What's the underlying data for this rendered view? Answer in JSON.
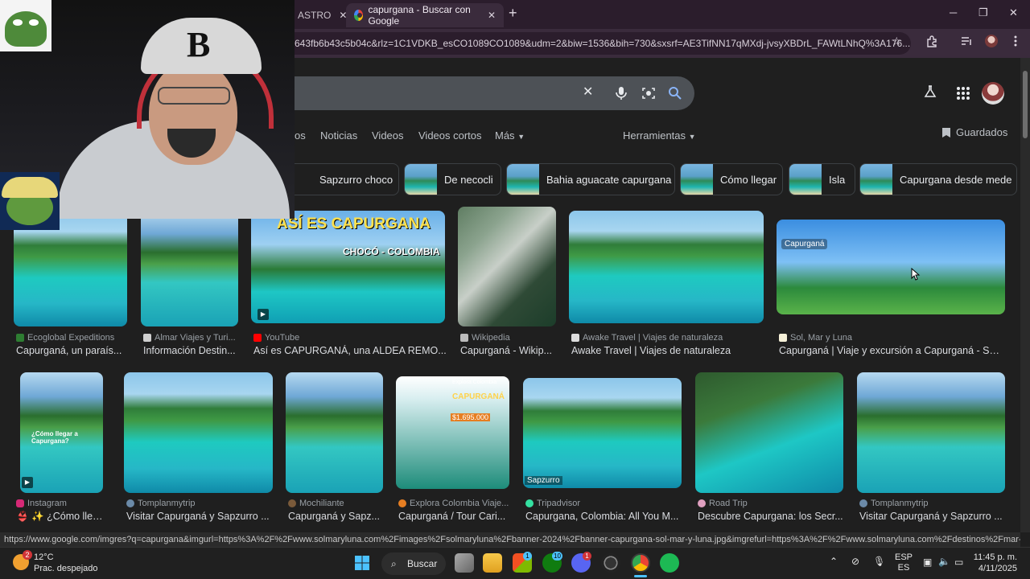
{
  "browser": {
    "tabs": [
      {
        "label": "ASTRO",
        "active": false
      },
      {
        "label": "capurgana - Buscar con Google",
        "active": true
      }
    ],
    "new_tab_glyph": "+",
    "url": "643fb6b43c5b04c&rlz=1C1VDKB_esCO1089CO1089&udm=2&biw=1536&bih=730&sxsrf=AE3TifNN17qMXdj-jvsyXBDrL_FAWtLNhQ%3A176...",
    "status_url": "https://www.google.com/imgres?q=capurgana&imgurl=https%3A%2F%2Fwww.solmaryluna.com%2Fimages%2Fsolmaryluna%2Fbanner-2024%2Fbanner-capurgana-sol-mar-y-luna.jpg&imgrefurl=https%3A%2F%2Fwww.solmaryluna.com%2Fdestinos%2Fmar-y-playa%2Fcapurgana..."
  },
  "search": {
    "nav_tabs": [
      "os",
      "Noticias",
      "Videos",
      "Videos cortos",
      "Más",
      "Herramientas"
    ],
    "saved_label": "Guardados",
    "chips": [
      "Sapzurro choco",
      "De necocli",
      "Bahia aguacate capurgana",
      "Cómo llegar",
      "Isla",
      "Capurgana desde mede"
    ]
  },
  "results_row1": [
    {
      "source": "Ecoglobal Expeditions",
      "title": "Capurganá, un paraís...",
      "color": "#2e7d32"
    },
    {
      "source": "Almar Viajes y Turi...",
      "title": "Información Destin...",
      "color": "#cfcfcf"
    },
    {
      "source": "YouTube",
      "title": "Así es CAPURGANÁ, una ALDEA REMO...",
      "color": "#ff0000"
    },
    {
      "source": "Wikipedia",
      "title": "Capurganá - Wikip...",
      "color": "#bbbbbb"
    },
    {
      "source": "Awake Travel | Viajes de naturaleza",
      "title": "Awake Travel | Viajes de naturaleza",
      "color": "#dddddd"
    },
    {
      "source": "Sol, Mar y Luna",
      "title": "Capurganá | Viaje y excursión a Capurganá - Sol,...",
      "color": "#f5f0d8"
    }
  ],
  "results_row2": [
    {
      "source": "Instagram",
      "title": "👙 ✨ ¿Cómo lleg...",
      "color": "#d62976"
    },
    {
      "source": "Tomplanmytrip",
      "title": "Visitar Capurganá y Sapzurro ...",
      "color": "#6b8aa8"
    },
    {
      "source": "Mochiliante",
      "title": "Capurganá y Sapz...",
      "color": "#7a5a3a"
    },
    {
      "source": "Explora Colombia Viaje...",
      "title": "Capurganá / Tour Cari...",
      "color": "#e67e22"
    },
    {
      "source": "Tripadvisor",
      "title": "Capurgana, Colombia: All You M...",
      "color": "#34e0a1"
    },
    {
      "source": "Road Trip",
      "title": "Descubre Capurgana: los Secr...",
      "color": "#e0a0c0"
    },
    {
      "source": "Tomplanmytrip",
      "title": "Visitar Capurganá y Sapzurro ...",
      "color": "#6b8aa8"
    }
  ],
  "image_overlays": {
    "yt_title": "ASÍ ES CAPURGANA",
    "yt_sub": "CHOCÓ - COLOMBIA",
    "sign_tag": "Capurganá",
    "insta_text": "¿Cómo llegar a Capurgana?",
    "poster_title": "CAPURGANÁ",
    "poster_price": "$1.695.000",
    "poster_brand": "Explora Colombia",
    "trip_tag": "Sapzurro"
  },
  "taskbar": {
    "weather_temp": "12°C",
    "weather_desc": "Prac. despejado",
    "weather_badge": "2",
    "search_label": "Buscar",
    "lang_top": "ESP",
    "lang_bottom": "ES",
    "time": "11:45 p. m.",
    "date": "4/11/2025",
    "badges": {
      "store": "1",
      "xbox": "10",
      "discord": "1"
    }
  },
  "webcam": {
    "cap_letter": "B"
  }
}
